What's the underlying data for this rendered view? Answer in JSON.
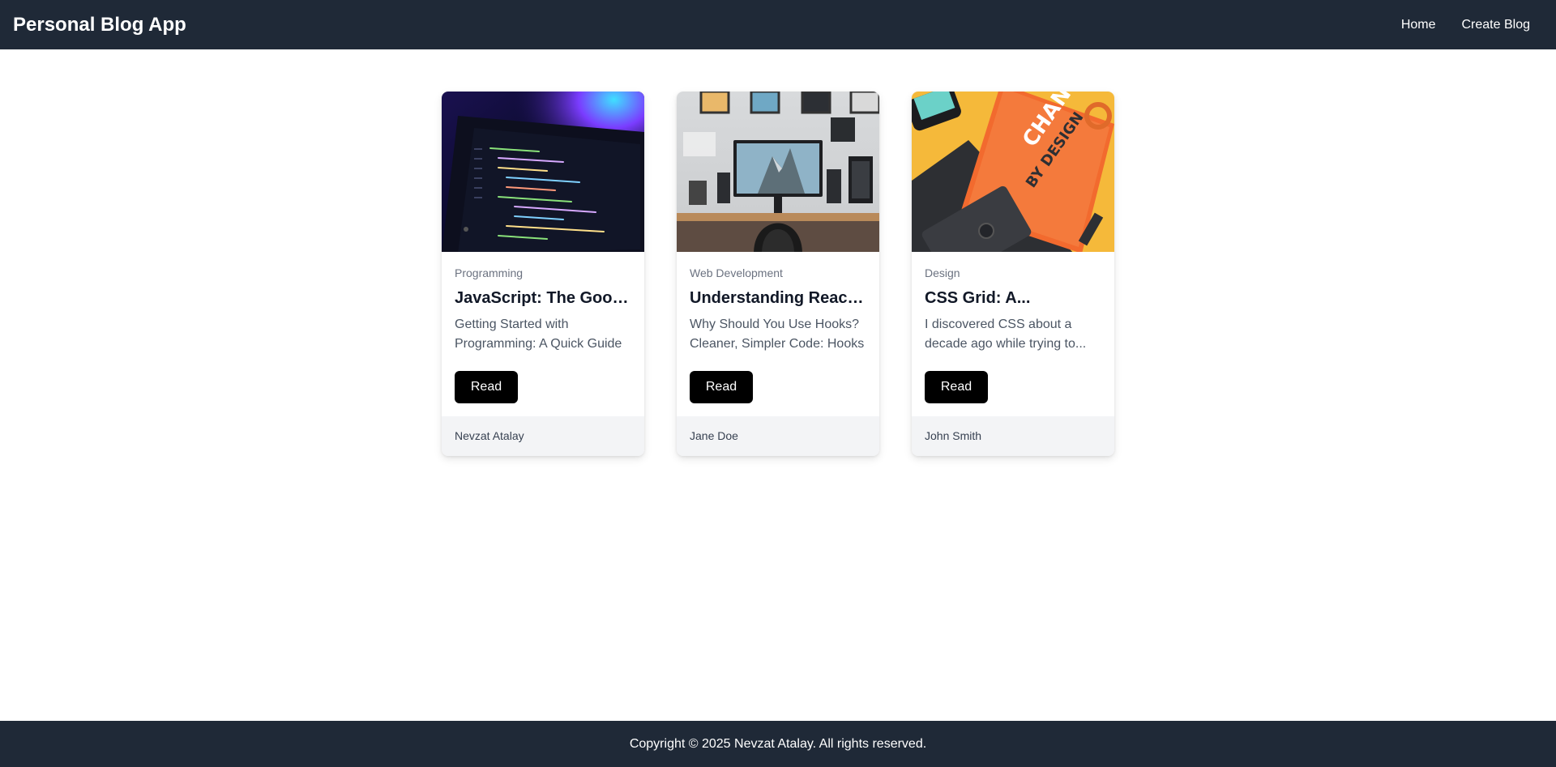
{
  "header": {
    "brand": "Personal Blog App",
    "nav": [
      "Home",
      "Create Blog"
    ]
  },
  "posts": [
    {
      "category": "Programming",
      "title": "JavaScript: The Good Parts",
      "excerpt_line1": "Getting Started with",
      "excerpt_line2": "Programming: A Quick Guide",
      "read_label": "Read",
      "author": "Nevzat Atalay"
    },
    {
      "category": "Web Development",
      "title": "Understanding React Hooks",
      "excerpt_line1": "Why Should You Use Hooks?",
      "excerpt_line2": "Cleaner, Simpler Code: Hooks",
      "read_label": "Read",
      "author": "Jane Doe"
    },
    {
      "category": "Design",
      "title": "CSS Grid: A...",
      "excerpt_line1": "I discovered CSS about a",
      "excerpt_line2": "decade ago while trying to...",
      "read_label": "Read",
      "author": "John Smith"
    }
  ],
  "images": {
    "book_text_1": "CHANGE",
    "book_text_2": "BY DESIGN"
  },
  "footer": {
    "copyright": "Copyright © 2025 Nevzat Atalay. All rights reserved."
  },
  "colors": {
    "header_bg": "#1f2937",
    "button_bg": "#000000",
    "card_footer_bg": "#f3f4f6"
  }
}
